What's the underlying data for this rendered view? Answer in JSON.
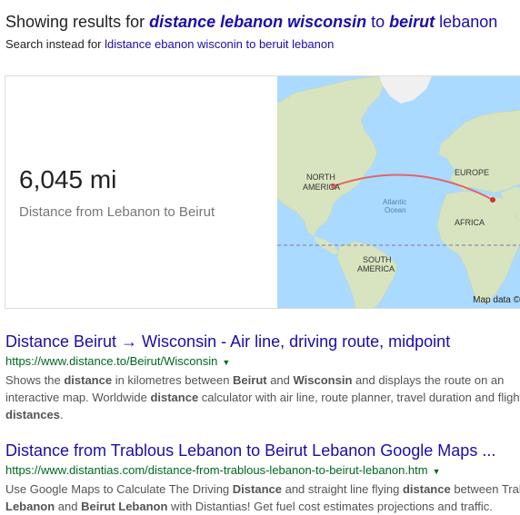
{
  "spelling": {
    "prefix": "Showing results for ",
    "q1": "distance lebanon wisconsin",
    "mid": " to ",
    "q2": "beirut",
    "suffix": " lebanon",
    "instead_prefix": "Search instead for ",
    "instead_query": "ldistance ebanon wisconin to beruit lebanon"
  },
  "distance_card": {
    "value": "6,045 mi",
    "label": "Distance from Lebanon to Beirut",
    "map": {
      "labels": {
        "north_america_1": "NORTH",
        "north_america_2": "AMERICA",
        "europe": "EUROPE",
        "atlantic_1": "Atlantic",
        "atlantic_2": "Ocean",
        "africa": "AFRICA",
        "south_america_1": "SOUTH",
        "south_america_2": "AMERICA"
      },
      "attribution": "Map data ©",
      "colors": {
        "water": "#aadaff",
        "land": "#d8e4bf",
        "route": "#e06666"
      }
    }
  },
  "results": [
    {
      "title": "Distance Beirut → Wisconsin - Air line, driving route, midpoint",
      "url": "https://www.distance.to/Beirut/Wisconsin",
      "snippet_line1": [
        {
          "t": "Shows the ",
          "b": false
        },
        {
          "t": "distance",
          "b": true
        },
        {
          "t": " in kilometres between ",
          "b": false
        },
        {
          "t": "Beirut",
          "b": true
        },
        {
          "t": " and ",
          "b": false
        },
        {
          "t": "Wisconsin",
          "b": true
        },
        {
          "t": " and displays the route on an",
          "b": false
        }
      ],
      "snippet_line2": [
        {
          "t": "interactive map. Worldwide ",
          "b": false
        },
        {
          "t": "distance",
          "b": true
        },
        {
          "t": " calculator with air line, route planner, travel duration and flight",
          "b": false
        }
      ],
      "snippet_line3": [
        {
          "t": "distances",
          "b": true
        },
        {
          "t": ".",
          "b": false
        }
      ]
    },
    {
      "title": "Distance from Trablous Lebanon to Beirut Lebanon Google Maps ...",
      "url": "https://www.distantias.com/distance-from-trablous-lebanon-to-beirut-lebanon.htm",
      "snippet_line1": [
        {
          "t": "Use Google Maps to Calculate The Driving ",
          "b": false
        },
        {
          "t": "Distance",
          "b": true
        },
        {
          "t": " and straight line flying ",
          "b": false
        },
        {
          "t": "distance",
          "b": true
        },
        {
          "t": " between Trab",
          "b": false
        }
      ],
      "snippet_line2": [
        {
          "t": "Lebanon",
          "b": true
        },
        {
          "t": " and ",
          "b": false
        },
        {
          "t": "Beirut Lebanon",
          "b": true
        },
        {
          "t": " with Distantias! Get fuel cost estimates projections and traffic.",
          "b": false
        }
      ]
    }
  ]
}
